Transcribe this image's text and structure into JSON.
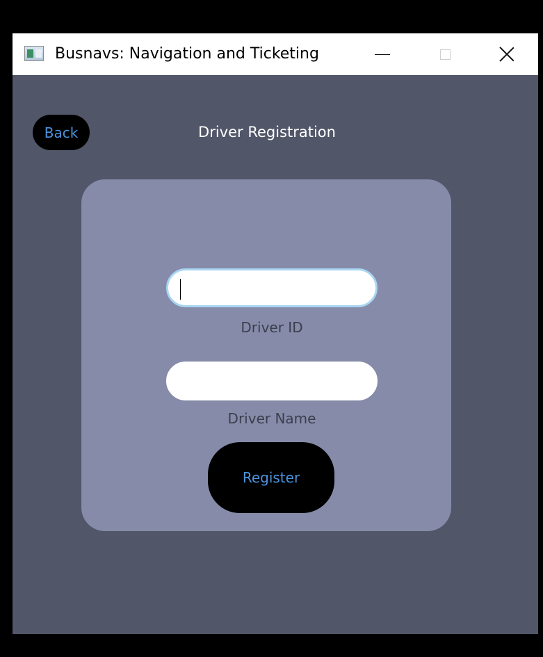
{
  "window": {
    "title": "Busnavs: Navigation and Ticketing"
  },
  "header": {
    "back_label": "Back",
    "title": "Driver Registration"
  },
  "form": {
    "driver_id": {
      "value": "",
      "label": "Driver ID"
    },
    "driver_name": {
      "value": "",
      "label": "Driver Name"
    },
    "register_label": "Register"
  },
  "colors": {
    "window_bg": "#515669",
    "card_bg": "#858ba9",
    "button_bg": "#000000",
    "button_text": "#4b93dc",
    "focus_border": "#a9d5f2"
  },
  "icons": {
    "app": "application-window-icon",
    "minimize": "minimize-icon",
    "maximize": "maximize-icon",
    "close": "close-icon"
  }
}
